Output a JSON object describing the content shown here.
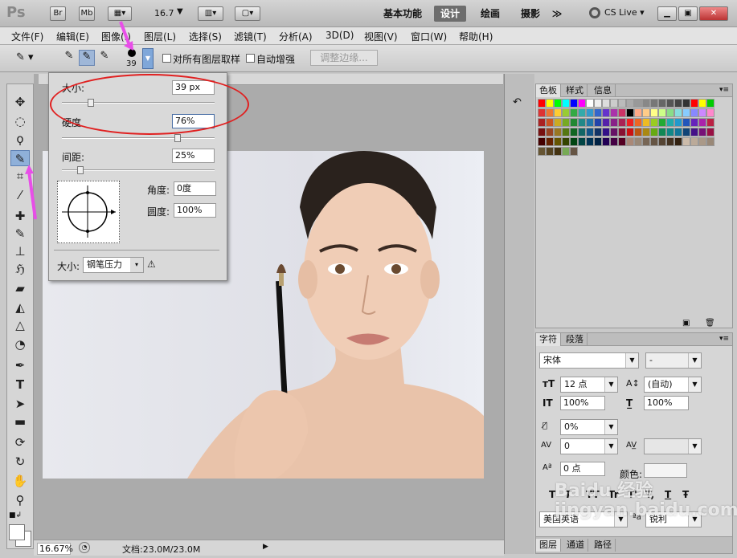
{
  "titlebar": {
    "logo": "Ps",
    "br": "Br",
    "mb": "Mb",
    "zoom": "16.7",
    "workspaces": [
      "基本功能",
      "设计",
      "绘画",
      "摄影"
    ],
    "more": "≫",
    "cslive": "CS Live"
  },
  "menus": [
    "文件(F)",
    "编辑(E)",
    "图像(I)",
    "图层(L)",
    "选择(S)",
    "滤镜(T)",
    "分析(A)",
    "3D(D)",
    "视图(V)",
    "窗口(W)",
    "帮助(H)"
  ],
  "options": {
    "brush_size_label": "39",
    "sample_all_layers": "对所有图层取样",
    "auto_enhance": "自动增强",
    "refine_edge": "调整边缘..."
  },
  "brush_popup": {
    "size_label": "大小:",
    "size_value": "39 px",
    "hardness_label": "硬度",
    "hardness_value": "76%",
    "spacing_label": "间距:",
    "spacing_value": "25%",
    "angle_label": "角度:",
    "angle_value": "0度",
    "roundness_label": "圆度:",
    "roundness_value": "100%",
    "control_label": "大小:",
    "control_value": "钢笔压力"
  },
  "status": {
    "zoom": "16.67%",
    "doc": "文档:23.0M/23.0M"
  },
  "swatches_panel": {
    "tabs": [
      "色板",
      "样式",
      "信息"
    ]
  },
  "char_panel": {
    "tabs": [
      "字符",
      "段落"
    ],
    "font_family": "宋体",
    "font_style": "-",
    "font_size": "12 点",
    "leading": "(自动)",
    "vscale": "100%",
    "hscale": "100%",
    "tracking_pct": "0%",
    "kerning": "0",
    "baseline": "0 点",
    "color_label": "颜色:",
    "language": "美国英语",
    "antialias": "锐利",
    "style_buttons": [
      "T",
      "T",
      "TT",
      "Tr",
      "T'",
      "T,",
      "T",
      "Ŧ"
    ]
  },
  "bottom_tabs": [
    "图层",
    "通道",
    "路径"
  ],
  "watermark": "Baidu 经验 jingyan.baidu.com",
  "colors": {
    "accent_red": "#e02020",
    "pink_arrow": "#e84ee8",
    "active_workspace": "#6d6d6d"
  }
}
